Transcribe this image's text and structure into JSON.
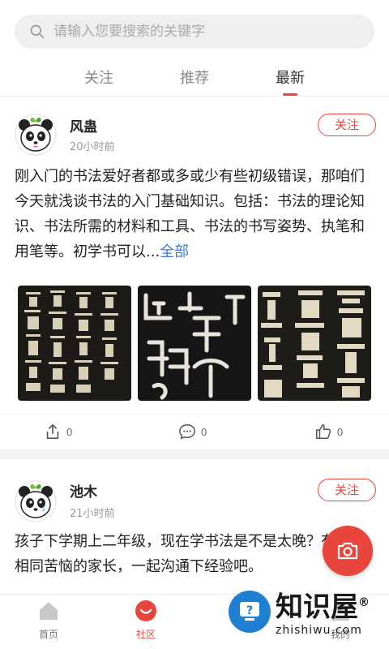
{
  "search": {
    "placeholder": "请输入您要搜索的关键字"
  },
  "tabs": [
    {
      "label": "关注"
    },
    {
      "label": "推荐"
    },
    {
      "label": "最新"
    }
  ],
  "posts": [
    {
      "username": "风蛊",
      "time": "20小时前",
      "follow_label": "关注",
      "content": "刚入门的书法爱好者都或多或少有些初级错误，那咱们今天就浅谈书法的入门基础知识。包括：书法的理论知识、书法所需的材料和工具、书法的书写姿势、执笔和用笔等。初学书可以...",
      "more_label": "全部",
      "shares": "0",
      "comments": "0",
      "likes": "0"
    },
    {
      "username": "池木",
      "time": "21小时前",
      "follow_label": "关注",
      "content": "孩子下学期上二年级，现在学书法是不是太晚？有没有相同苦恼的家长，一起沟通下经验吧。"
    }
  ],
  "nav": [
    {
      "label": "首页"
    },
    {
      "label": "社区"
    },
    {
      "label": ""
    },
    {
      "label": "我的"
    }
  ],
  "watermark": {
    "cn": "知识屋",
    "en": "zhishiwu.com"
  },
  "colors": {
    "accent": "#e8453c",
    "link": "#3a7bd5"
  }
}
